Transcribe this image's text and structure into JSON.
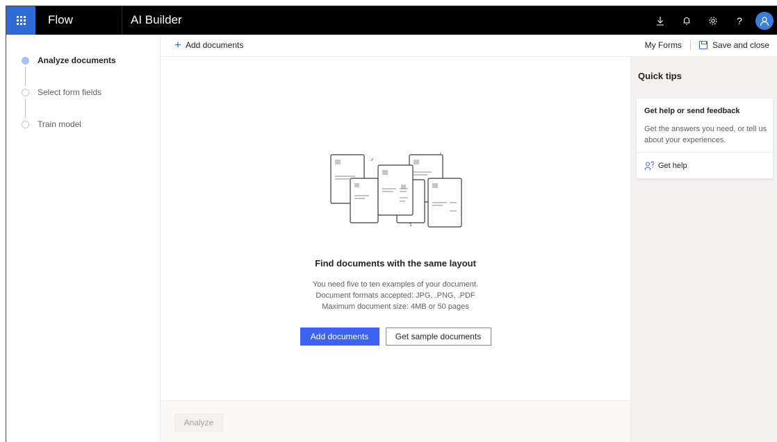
{
  "topbar": {
    "waffle_icon": "waffle-icon",
    "app_name": "Flow",
    "product_name": "AI Builder",
    "icons": [
      "download-icon",
      "bell-icon",
      "gear-icon",
      "help-icon",
      "avatar-icon"
    ],
    "help_glyph": "?"
  },
  "steps": [
    {
      "label": "Analyze documents",
      "state": "active"
    },
    {
      "label": "Select form fields",
      "state": "pending"
    },
    {
      "label": "Train model",
      "state": "pending"
    }
  ],
  "command_bar": {
    "add_documents": "Add documents",
    "my_forms": "My Forms",
    "save_and_close": "Save and close"
  },
  "main": {
    "illustration_icon": "documents-illustration",
    "title": "Find documents with the same layout",
    "description_lines": [
      "You need five to ten examples of your document.",
      "Document formats accepted: JPG, .PNG, .PDF",
      "Maximum document size: 4MB or 50 pages"
    ],
    "primary_button": "Add documents",
    "secondary_button": "Get sample documents"
  },
  "footer": {
    "analyze_button": "Analyze"
  },
  "quick_tips": {
    "title": "Quick tips",
    "card_title": "Get help or send feedback",
    "card_body": "Get the answers you need, or tell us about your experiences.",
    "get_help": "Get help"
  },
  "colors": {
    "accent": "#3b63f0",
    "waffle_bg": "#2f6bd8",
    "topbar_bg": "#000000",
    "active_step": "#a9c1f4"
  }
}
